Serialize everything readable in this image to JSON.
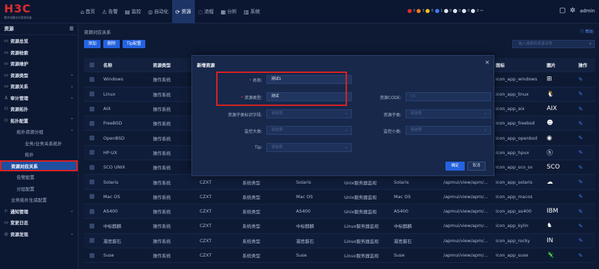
{
  "header": {
    "logo": "H3C",
    "logo_sub": "数字化解决方案领导者",
    "nav": [
      {
        "icon": "⌂",
        "label": "首页"
      },
      {
        "icon": "⚠",
        "label": "告警"
      },
      {
        "icon": "▤",
        "label": "监控"
      },
      {
        "icon": "◎",
        "label": "自动化"
      },
      {
        "icon": "⟳",
        "label": "资源"
      },
      {
        "icon": "◌",
        "label": "流程"
      },
      {
        "icon": "▦",
        "label": "分析"
      },
      {
        "icon": "▥",
        "label": "系统"
      }
    ],
    "active_nav": "资源",
    "status_counts": [
      "0",
      "3",
      "0",
      "1",
      "0",
      "0",
      "0",
      "0",
      "0"
    ],
    "user": "admin"
  },
  "sidebar": {
    "title": "资源",
    "items": [
      {
        "icon": "▭",
        "label": "资源总览"
      },
      {
        "icon": "▭",
        "label": "资源检索"
      },
      {
        "icon": "▭",
        "label": "资源维护"
      },
      {
        "icon": "▭",
        "label": "资源类型"
      },
      {
        "icon": "▭",
        "label": "资源关系"
      },
      {
        "icon": "♙",
        "label": "审计管理"
      },
      {
        "icon": "⚇",
        "label": "资源拓扑"
      },
      {
        "icon": "⚇",
        "label": "拓扑配置"
      }
    ],
    "sub_items": [
      "拓扑资源分组",
      "业务/业务关系拓扑",
      "拓扑",
      "资源对应关系",
      "告警配置",
      "分层配置",
      "业务拓扑生成配置"
    ],
    "bottom_items": [
      {
        "icon": "⚐",
        "label": "通知管理"
      },
      {
        "icon": "▭",
        "label": "变更日志"
      },
      {
        "icon": "◎",
        "label": "资源发现"
      }
    ]
  },
  "main": {
    "breadcrumb": "资源对应关系",
    "help": "ⓘ 帮助",
    "buttons": [
      "添加",
      "删除",
      "Tip配置"
    ],
    "search_placeholder": "输入搜索的资源名称",
    "columns": [
      "名称",
      "资源类型",
      "",
      "",
      "",
      "",
      "",
      "",
      "图标",
      "图片",
      "操作"
    ],
    "rows": [
      {
        "name": "Windows",
        "type": "操作系统",
        "code": "",
        "ctype": "",
        "dname": "",
        "mon": "",
        "mon2": "",
        "url": "",
        "icon": "icon_app_windows",
        "img": "⊞"
      },
      {
        "name": "Linux",
        "type": "操作系统",
        "code": "",
        "ctype": "",
        "dname": "",
        "mon": "",
        "mon2": "",
        "url": "",
        "icon": "icon_app_linux",
        "img": "🐧"
      },
      {
        "name": "AIX",
        "type": "操作系统",
        "code": "",
        "ctype": "",
        "dname": "",
        "mon": "",
        "mon2": "",
        "url": "",
        "icon": "icon_app_aix",
        "img": "AIX"
      },
      {
        "name": "FreeBSD",
        "type": "操作系统",
        "code": "",
        "ctype": "",
        "dname": "",
        "mon": "",
        "mon2": "",
        "url": "",
        "icon": "icon_app_freebsd",
        "img": "☻"
      },
      {
        "name": "OpenBSD",
        "type": "操作系统",
        "code": "",
        "ctype": "",
        "dname": "",
        "mon": "",
        "mon2": "",
        "url": "",
        "icon": "icon_app_openbsd",
        "img": "◉"
      },
      {
        "name": "HP-UX",
        "type": "操作系统",
        "code": "",
        "ctype": "",
        "dname": "",
        "mon": "",
        "mon2": "",
        "url": "",
        "icon": "icon_app_hpux",
        "img": "ⓗ"
      },
      {
        "name": "SCO UNIX",
        "type": "操作系统",
        "code": "",
        "ctype": "",
        "dname": "",
        "mon": "",
        "mon2": "",
        "url": "",
        "icon": "icon_app_sco_sv",
        "img": "SCO"
      },
      {
        "name": "Solaris",
        "type": "操作系统",
        "code": "CZXT",
        "ctype": "系统类型",
        "dname": "Solaris",
        "mon": "Unix服务器监视",
        "mon2": "Solaris",
        "url": "/apmui/view/apm/...",
        "icon": "icon_app_solaris",
        "img": "☁"
      },
      {
        "name": "Mac OS",
        "type": "操作系统",
        "code": "CZXT",
        "ctype": "系统类型",
        "dname": "Mac OS",
        "mon": "Unix服务器监视",
        "mon2": "Mac OS",
        "url": "/apmui/view/apm/...",
        "icon": "icon_app_macos",
        "img": ""
      },
      {
        "name": "AS400",
        "type": "操作系统",
        "code": "CZXT",
        "ctype": "系统类型",
        "dname": "AS400",
        "mon": "Unix服务器监视",
        "mon2": "AS400",
        "url": "/apmui/view/apm/...",
        "icon": "icon_app_as400",
        "img": "IBM"
      },
      {
        "name": "中标麒麟",
        "type": "操作系统",
        "code": "CZXT",
        "ctype": "系统类型",
        "dname": "中标麒麟",
        "mon": "Linux服务器监视",
        "mon2": "中标麒麟",
        "url": "/apmui/view/apm/...",
        "icon": "icon_app_kylin",
        "img": "♞"
      },
      {
        "name": "凝思磐石",
        "type": "操作系统",
        "code": "CZXT",
        "ctype": "系统类型",
        "dname": "凝思磐石",
        "mon": "Linux服务器监视",
        "mon2": "凝思磐石",
        "url": "/apmui/view/apm/...",
        "icon": "icon_app_rocky",
        "img": "IN"
      },
      {
        "name": "Suse",
        "type": "操作系统",
        "code": "CZXT",
        "ctype": "系统类型",
        "dname": "Suse",
        "mon": "Linux服务器监视",
        "mon2": "Suse",
        "url": "/apmui/view/apm/...",
        "icon": "icon_app_suse",
        "img": "🦎"
      }
    ]
  },
  "modal": {
    "title": "新增资源",
    "name_label": "名称:",
    "name_value": "测试1",
    "type_label": "资源类型:",
    "type_value": "测试",
    "code_label": "资源CODE:",
    "code_value": "CS",
    "subtype_field_label": "资源子类标识字段:",
    "subtype_field_ph": "请选择",
    "subtype_label": "资源子类:",
    "subtype_ph": "请选择",
    "mon_big_label": "监控大类:",
    "mon_big_ph": "请选择",
    "mon_small_label": "监控小类:",
    "mon_small_ph": "请选择",
    "tip_label": "Tip:",
    "tip_ph": "请选择",
    "ok": "确定",
    "cancel": "取消"
  },
  "colors": {
    "accent": "#2463e0",
    "highlight": "#e02020",
    "brand": "#e02d2d"
  }
}
